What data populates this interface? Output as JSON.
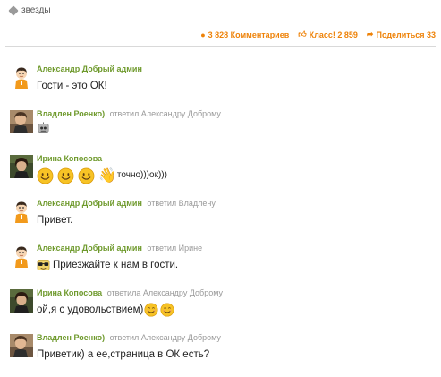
{
  "tag": {
    "label": "звезды"
  },
  "actions": {
    "comments": "3 828 Комментариев",
    "klass": "Класс! 2 859",
    "share": "Поделиться 33"
  },
  "comments": [
    {
      "author": "Александр Добрый админ",
      "reply": "",
      "text": "Гости - это ОК!"
    },
    {
      "author": "Владлен Роенко)",
      "reply": "ответил Александру Доброму",
      "text": ""
    },
    {
      "author": "Ирина Копосова",
      "reply": "",
      "text": "точно)))ок)))"
    },
    {
      "author": "Александр Добрый админ",
      "reply": "ответил Владлену",
      "text": "Привет."
    },
    {
      "author": "Александр Добрый админ",
      "reply": "ответил Ирине",
      "text": "Приезжайте к нам в гости."
    },
    {
      "author": "Ирина Копосова",
      "reply": "ответила Александру Доброму",
      "text": "ой,я с удовольствием)"
    },
    {
      "author": "Владлен Роенко)",
      "reply": "ответил Александру Доброму",
      "text": "Приветик) а ее,страница в ОК есть?"
    }
  ],
  "icons": {
    "tag": "tag-icon",
    "comments": "speech-bubble-icon",
    "klass": "thumbs-up-icon",
    "share": "share-arrow-icon"
  },
  "colors": {
    "accent": "#ee8208",
    "author": "#6f9a2d",
    "reply": "#999999",
    "text": "#222222"
  }
}
